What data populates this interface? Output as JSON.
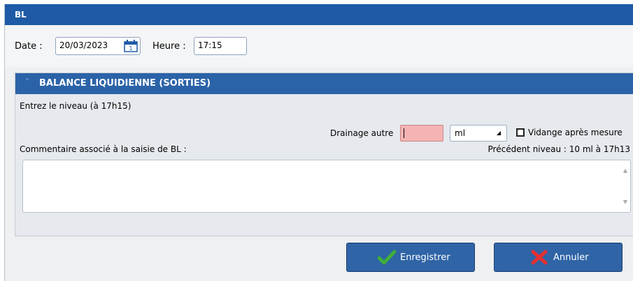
{
  "window": {
    "title": "BL"
  },
  "header": {
    "date_label": "Date :",
    "date_value": "20/03/2023",
    "time_label": "Heure :",
    "time_value": "17:15"
  },
  "section": {
    "title": "BALANCE LIQUIDIENNE (SORTIES)",
    "instruction": "Entrez le niveau (à 17h15)",
    "drainage_label": "Drainage autre",
    "drainage_value": "",
    "unit_selected": "ml",
    "vidange_label": "Vidange après mesure",
    "comment_label": "Commentaire associé à la saisie de BL :",
    "previous_level": "Précédent niveau : 10 ml à 17h13",
    "comment_value": ""
  },
  "buttons": {
    "save_label": "Enregistrer",
    "cancel_label": "Annuler"
  },
  "colors": {
    "titlebar": "#1e5aa6",
    "section_header": "#2b63a8",
    "button": "#2f64a6",
    "drainage_input_bg": "#f6b3b3",
    "check_green": "#3fae3a",
    "cross_red": "#e53030"
  }
}
